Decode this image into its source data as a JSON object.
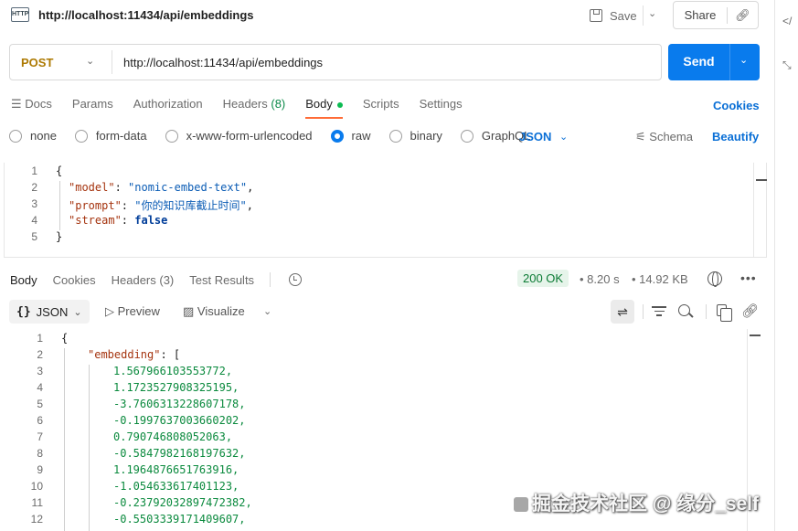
{
  "topbar": {
    "badge": "HTTP",
    "title": "http://localhost:11434/api/embeddings",
    "save_label": "Save",
    "share_label": "Share"
  },
  "request": {
    "method": "POST",
    "url": "http://localhost:11434/api/embeddings",
    "send_label": "Send"
  },
  "req_tabs": {
    "docs": "Docs",
    "params": "Params",
    "authorization": "Authorization",
    "headers": "Headers",
    "headers_count": "(8)",
    "body": "Body",
    "scripts": "Scripts",
    "settings": "Settings",
    "cookies": "Cookies"
  },
  "body_types": {
    "none": "none",
    "form_data": "form-data",
    "urlencoded": "x-www-form-urlencoded",
    "raw": "raw",
    "binary": "binary",
    "graphql": "GraphQL",
    "selected": "raw",
    "format": "JSON",
    "schema": "Schema",
    "beautify": "Beautify"
  },
  "request_body": {
    "line_numbers": [
      "1",
      "2",
      "3",
      "4",
      "5"
    ],
    "open_brace": "{",
    "close_brace": "}",
    "fields": [
      {
        "key": "\"model\"",
        "value": "\"nomic-embed-text\"",
        "comma": ","
      },
      {
        "key": "\"prompt\"",
        "value": "\"你的知识库截止时间\"",
        "comma": ","
      },
      {
        "key": "\"stream\"",
        "value": "false",
        "comma": ""
      }
    ]
  },
  "resp_tabs": {
    "body": "Body",
    "cookies": "Cookies",
    "headers": "Headers (3)",
    "test_results": "Test Results"
  },
  "response_meta": {
    "status": "200 OK",
    "time": "8.20 s",
    "size": "14.92 KB"
  },
  "resp_toolbar": {
    "format": "JSON",
    "preview": "Preview",
    "visualize": "Visualize"
  },
  "response_body": {
    "line_numbers": [
      "1",
      "2",
      "3",
      "4",
      "5",
      "6",
      "7",
      "8",
      "9",
      "10",
      "11",
      "12"
    ],
    "open_brace": "{",
    "key": "\"embedding\"",
    "values": [
      "1.567966103553772,",
      "1.1723527908325195,",
      "-3.7606313228607178,",
      "-0.1997637003660202,",
      "0.790746808052063,",
      "-0.5847982168197632,",
      "1.1964876651763916,",
      "-1.054633617401123,",
      "-0.23792032897472382,",
      "-0.5503339171409607,"
    ]
  },
  "watermark": "掘金技术社区 @ 缘分_self",
  "colors": {
    "accent": "#097bed",
    "tab_indicator": "#ff6c37",
    "method": "#ad7a03",
    "status_ok": "#0a7a33"
  }
}
